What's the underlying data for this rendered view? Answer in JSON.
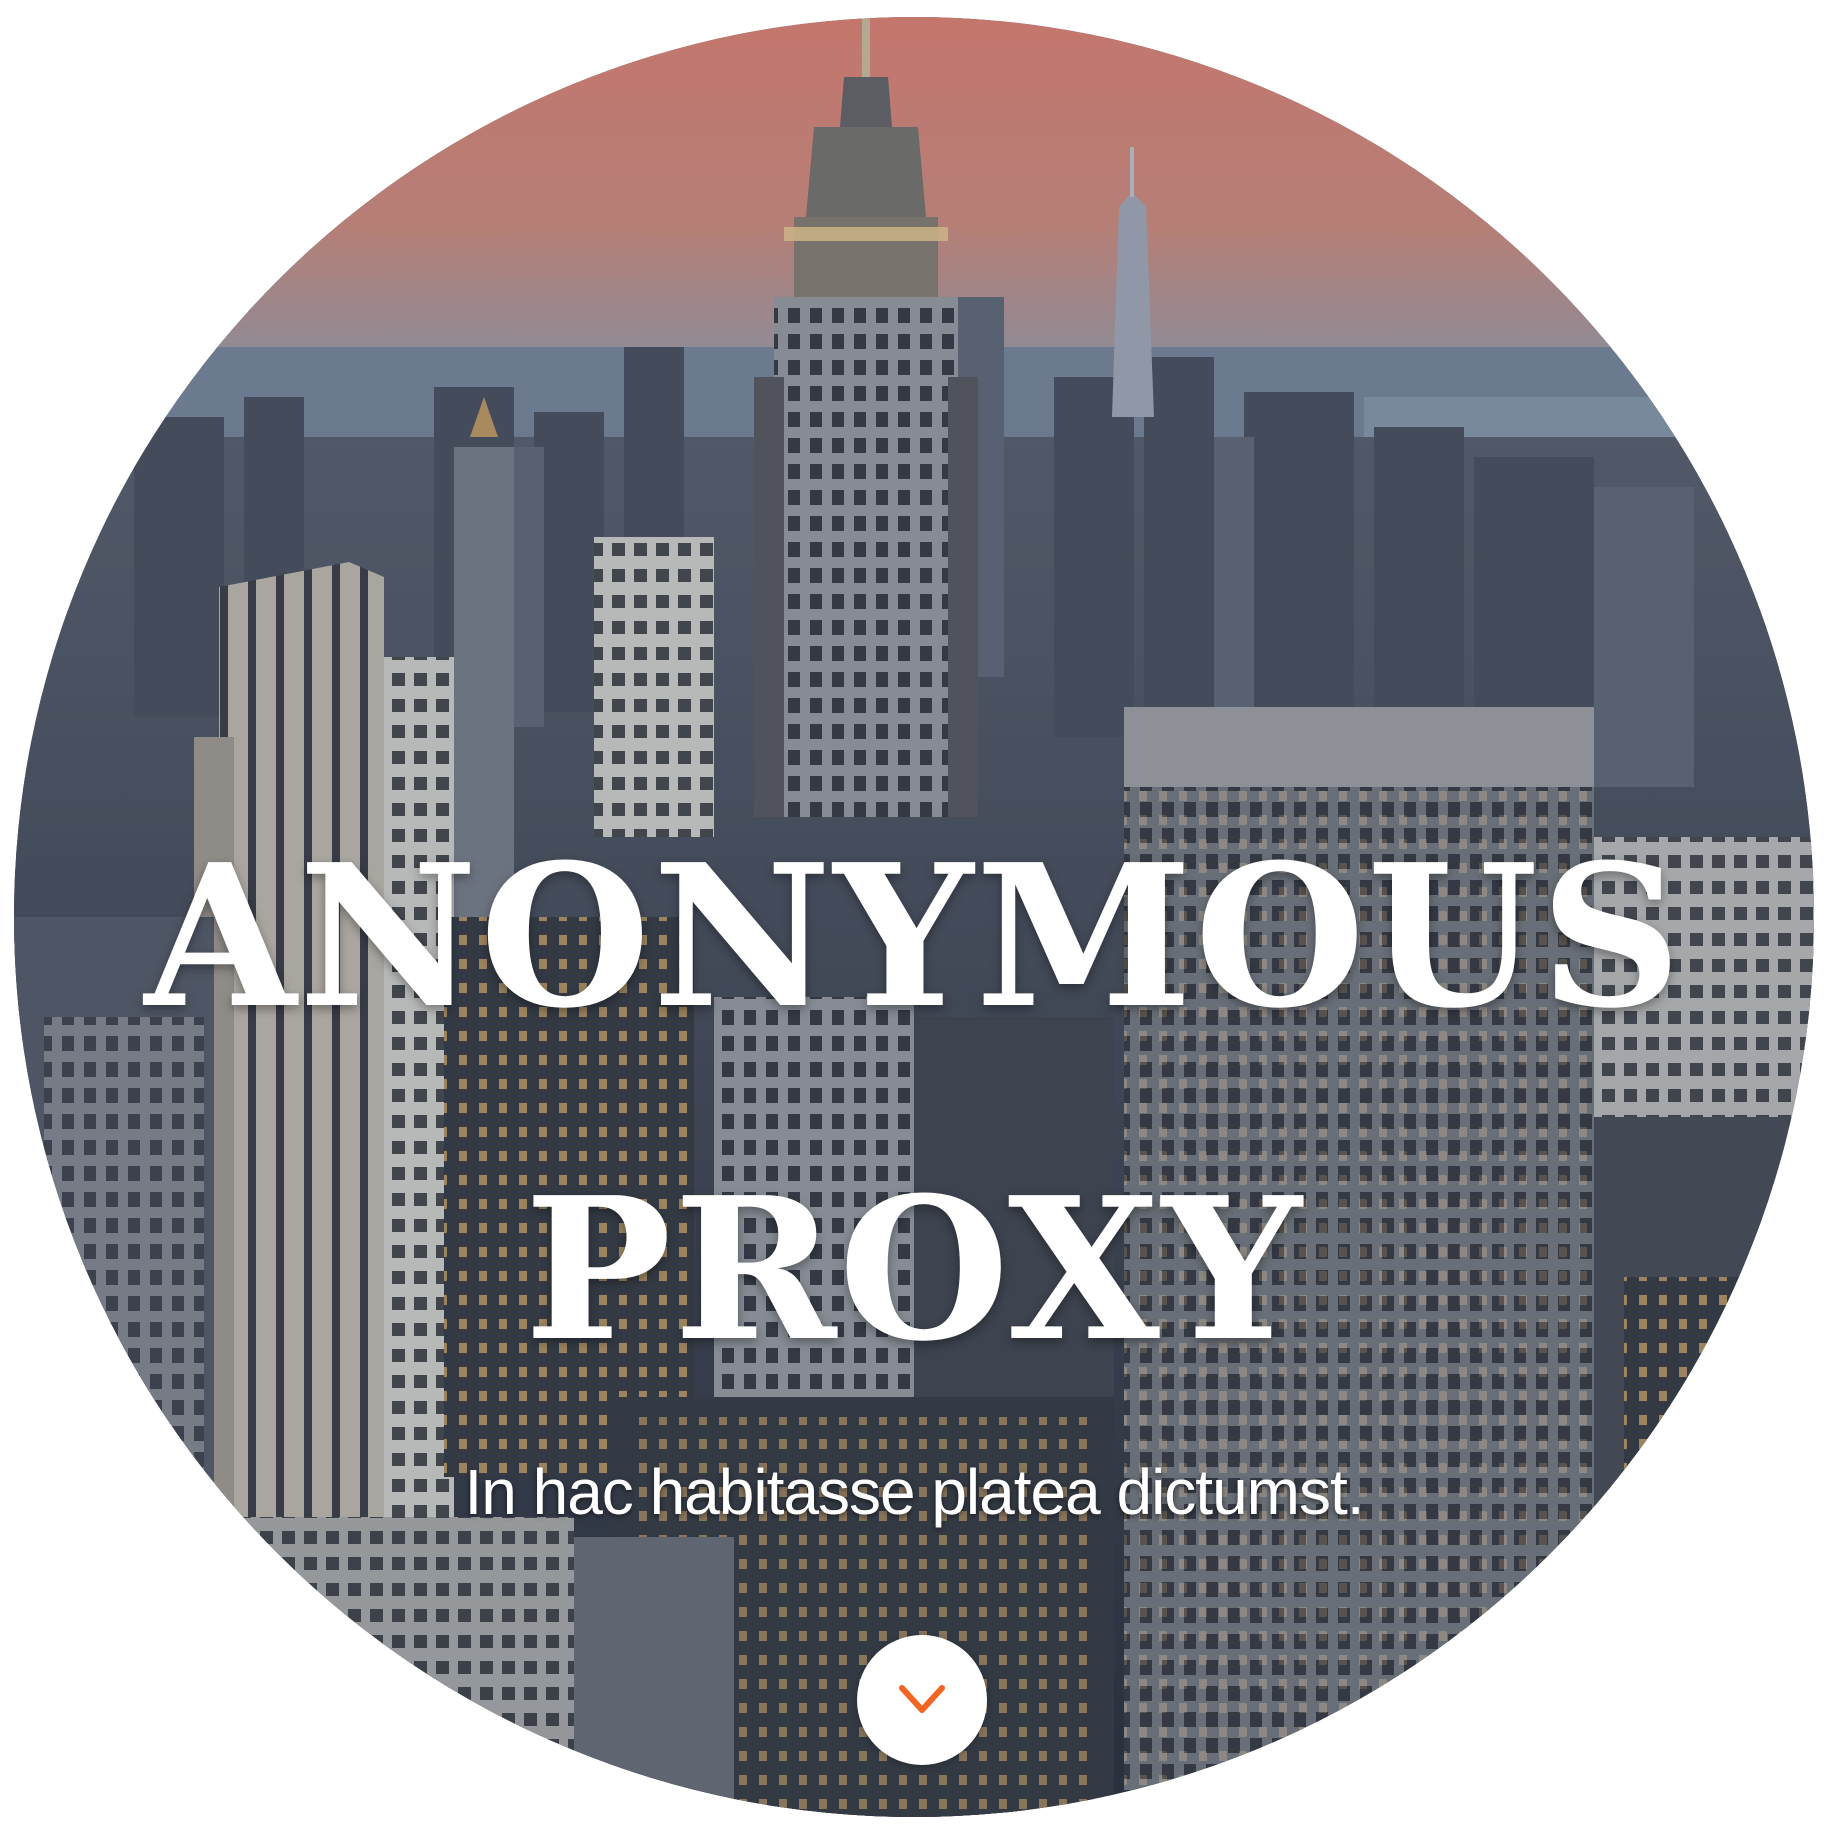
{
  "hero": {
    "title_line1": "ANONYMOUS",
    "title_line2": "PROXY",
    "subtitle": "In hac habitasse platea dictumst."
  },
  "scroll_button": {
    "icon": "chevron-down-icon",
    "icon_color": "#f26522"
  },
  "colors": {
    "sky_top": "#e9897a",
    "sky_horizon": "#9aa7b8",
    "water": "#6e8196",
    "city_dark": "#2c3340",
    "city_mid": "#5d6675",
    "title_text": "#ffffff",
    "accent": "#f26522"
  }
}
